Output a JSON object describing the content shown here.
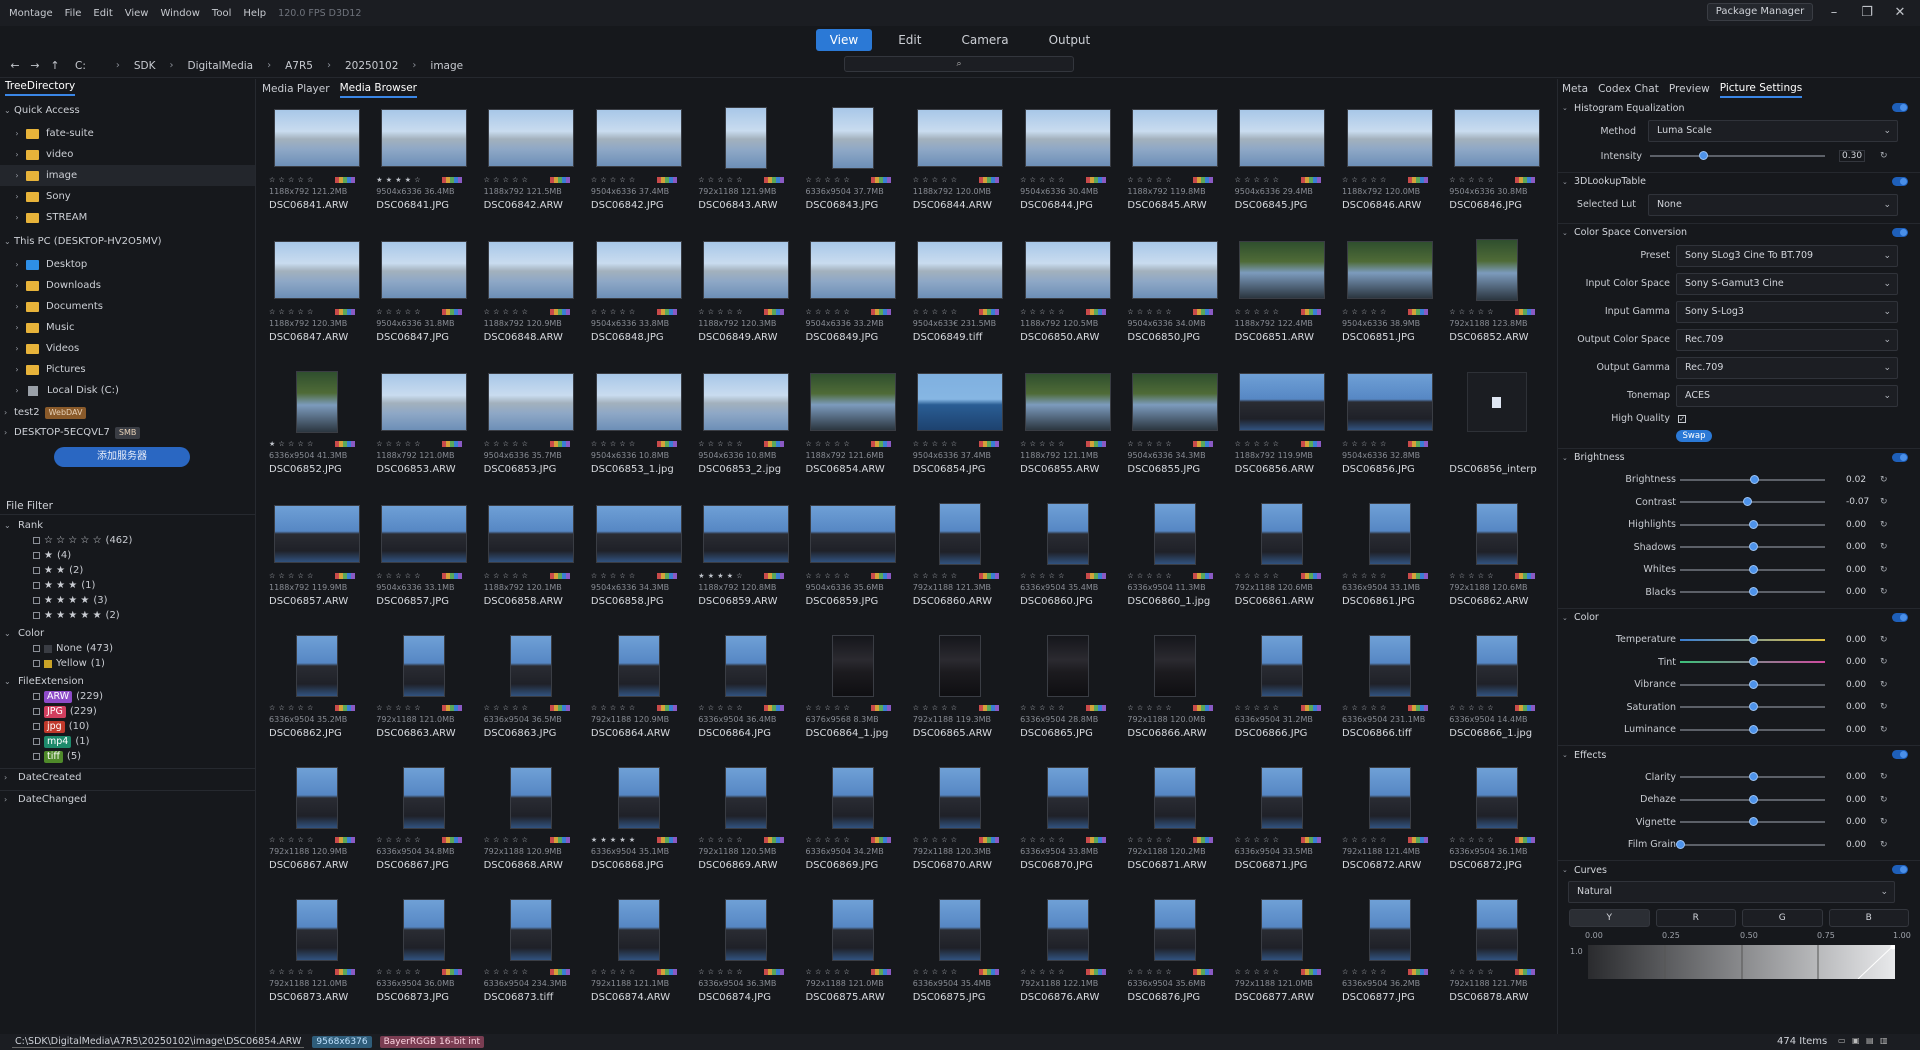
{
  "menubar": {
    "items": [
      "Montage",
      "File",
      "Edit",
      "View",
      "Window",
      "Tool",
      "Help"
    ],
    "fps": "120.0 FPS  D3D12",
    "package_manager": "Package Manager"
  },
  "modes": [
    "View",
    "Edit",
    "Camera",
    "Output"
  ],
  "path": {
    "crumbs": [
      "C:",
      "SDK",
      "DigitalMedia",
      "A7R5",
      "20250102",
      "image"
    ],
    "search_icon": "search-icon"
  },
  "left": {
    "tabs": [
      "TreeDirectory"
    ],
    "quick_access": "Quick Access",
    "quick_items": [
      "fate-suite",
      "video",
      "image",
      "Sony",
      "STREAM"
    ],
    "this_pc": "This PC (DESKTOP-HV2O5MV)",
    "pc_items": [
      "Desktop",
      "Downloads",
      "Documents",
      "Music",
      "Videos",
      "Pictures",
      "Local Disk (C:)"
    ],
    "remote": [
      {
        "name": "test2",
        "badge": "WebDAV",
        "color": "#8a5a2a"
      },
      {
        "name": "DESKTOP-5ECQVL7",
        "badge": "SMB",
        "color": "#3a3d44"
      }
    ],
    "add_server": "添加服务器"
  },
  "filter": {
    "title": "File Filter",
    "rank_label": "Rank",
    "rank": [
      {
        "stars": "☆ ☆ ☆ ☆ ☆",
        "count": "(462)"
      },
      {
        "stars": "★",
        "count": "(4)"
      },
      {
        "stars": "★ ★",
        "count": "(2)"
      },
      {
        "stars": "★ ★ ★",
        "count": "(1)"
      },
      {
        "stars": "★ ★ ★ ★",
        "count": "(3)"
      },
      {
        "stars": "★ ★ ★ ★ ★",
        "count": "(2)"
      }
    ],
    "color_label": "Color",
    "colors": [
      {
        "name": "None",
        "count": "(473)",
        "color": "#3a3d44"
      },
      {
        "name": "Yellow",
        "count": "(1)",
        "color": "#c9a227"
      }
    ],
    "ext_label": "FileExtension",
    "exts": [
      {
        "name": "ARW",
        "count": "(229)",
        "color": "#8e4bc8"
      },
      {
        "name": "JPG",
        "count": "(229)",
        "color": "#d13f5f"
      },
      {
        "name": "jpg",
        "count": "(10)",
        "color": "#c0392b"
      },
      {
        "name": "mp4",
        "count": "(1)",
        "color": "#1d8a6b"
      },
      {
        "name": "tiff",
        "count": "(5)",
        "color": "#4f8a2a"
      }
    ],
    "date_created": "DateCreated",
    "date_changed": "DateChanged"
  },
  "center": {
    "tabs": [
      "Media Player",
      "Media Browser"
    ]
  },
  "files": [
    {
      "n": "DSC06841.ARW",
      "m": "1188x792  121.2MB",
      "t": "sky",
      "o": "l",
      "r": "☆ ☆ ☆ ☆ ☆"
    },
    {
      "n": "DSC06841.JPG",
      "m": "9504x6336  36.4MB",
      "t": "sky",
      "o": "l",
      "r": "★ ★ ★ ★ ☆"
    },
    {
      "n": "DSC06842.ARW",
      "m": "1188x792  121.5MB",
      "t": "sky",
      "o": "l",
      "r": "☆ ☆ ☆ ☆ ☆"
    },
    {
      "n": "DSC06842.JPG",
      "m": "9504x6336  37.4MB",
      "t": "sky",
      "o": "l",
      "r": "☆ ☆ ☆ ☆ ☆"
    },
    {
      "n": "DSC06843.ARW",
      "m": "792x1188  121.9MB",
      "t": "sky",
      "o": "p",
      "r": "☆ ☆ ☆ ☆ ☆"
    },
    {
      "n": "DSC06843.JPG",
      "m": "6336x9504  37.7MB",
      "t": "sky",
      "o": "p",
      "r": "☆ ☆ ☆ ☆ ☆"
    },
    {
      "n": "DSC06844.ARW",
      "m": "1188x792  120.0MB",
      "t": "sky",
      "o": "l",
      "r": "☆ ☆ ☆ ☆ ☆"
    },
    {
      "n": "DSC06844.JPG",
      "m": "9504x6336  30.4MB",
      "t": "sky",
      "o": "l",
      "r": "☆ ☆ ☆ ☆ ☆"
    },
    {
      "n": "DSC06845.ARW",
      "m": "1188x792  119.8MB",
      "t": "sky",
      "o": "l",
      "r": "☆ ☆ ☆ ☆ ☆"
    },
    {
      "n": "DSC06845.JPG",
      "m": "9504x6336  29.4MB",
      "t": "sky",
      "o": "l",
      "r": "☆ ☆ ☆ ☆ ☆"
    },
    {
      "n": "DSC06846.ARW",
      "m": "1188x792  120.0MB",
      "t": "sky",
      "o": "l",
      "r": "☆ ☆ ☆ ☆ ☆"
    },
    {
      "n": "DSC06846.JPG",
      "m": "9504x6336  30.8MB",
      "t": "sky",
      "o": "l",
      "r": "☆ ☆ ☆ ☆ ☆"
    },
    {
      "n": "DSC06847.ARW",
      "m": "1188x792  120.3MB",
      "t": "sky",
      "o": "l",
      "r": "☆ ☆ ☆ ☆ ☆"
    },
    {
      "n": "DSC06847.JPG",
      "m": "9504x6336  31.8MB",
      "t": "sky",
      "o": "l",
      "r": "☆ ☆ ☆ ☆ ☆"
    },
    {
      "n": "DSC06848.ARW",
      "m": "1188x792  120.9MB",
      "t": "sky",
      "o": "l",
      "r": "☆ ☆ ☆ ☆ ☆"
    },
    {
      "n": "DSC06848.JPG",
      "m": "9504x6336  33.8MB",
      "t": "sky",
      "o": "l",
      "r": "☆ ☆ ☆ ☆ ☆"
    },
    {
      "n": "DSC06849.ARW",
      "m": "1188x792  120.3MB",
      "t": "sky",
      "o": "l",
      "r": "☆ ☆ ☆ ☆ ☆"
    },
    {
      "n": "DSC06849.JPG",
      "m": "9504x6336  33.2MB",
      "t": "sky",
      "o": "l",
      "r": "☆ ☆ ☆ ☆ ☆"
    },
    {
      "n": "DSC06849.tiff",
      "m": "9504x633€ 231.5MB",
      "t": "sky",
      "o": "l",
      "r": "☆ ☆ ☆ ☆ ☆"
    },
    {
      "n": "DSC06850.ARW",
      "m": "1188x792  120.5MB",
      "t": "sky",
      "o": "l",
      "r": "☆ ☆ ☆ ☆ ☆"
    },
    {
      "n": "DSC06850.JPG",
      "m": "9504x6336  34.0MB",
      "t": "sky",
      "o": "l",
      "r": "☆ ☆ ☆ ☆ ☆"
    },
    {
      "n": "DSC06851.ARW",
      "m": "1188x792  122.4MB",
      "t": "green",
      "o": "l",
      "r": "☆ ☆ ☆ ☆ ☆"
    },
    {
      "n": "DSC06851.JPG",
      "m": "9504x6336  38.9MB",
      "t": "green",
      "o": "l",
      "r": "☆ ☆ ☆ ☆ ☆"
    },
    {
      "n": "DSC06852.ARW",
      "m": "792x1188  123.8MB",
      "t": "green",
      "o": "p",
      "r": "☆ ☆ ☆ ☆ ☆"
    },
    {
      "n": "DSC06852.JPG",
      "m": "6336x9504  41.3MB",
      "t": "green",
      "o": "p",
      "r": "★ ☆ ☆ ☆ ☆"
    },
    {
      "n": "DSC06853.ARW",
      "m": "1188x792  121.0MB",
      "t": "sky",
      "o": "l",
      "r": "☆ ☆ ☆ ☆ ☆"
    },
    {
      "n": "DSC06853.JPG",
      "m": "9504x6336  35.7MB",
      "t": "sky",
      "o": "l",
      "r": "☆ ☆ ☆ ☆ ☆"
    },
    {
      "n": "DSC06853_1.jpg",
      "m": "9504x6336  10.8MB",
      "t": "sky",
      "o": "l",
      "r": "☆ ☆ ☆ ☆ ☆"
    },
    {
      "n": "DSC06853_2.jpg",
      "m": "9504x6336  10.8MB",
      "t": "sky",
      "o": "l",
      "r": "☆ ☆ ☆ ☆ ☆"
    },
    {
      "n": "DSC06854.ARW",
      "m": "1188x792  121.6MB",
      "t": "green",
      "o": "l",
      "r": "☆ ☆ ☆ ☆ ☆"
    },
    {
      "n": "DSC06854.JPG",
      "m": "9504x6336  37.4MB",
      "t": "bluewt",
      "o": "l",
      "r": "☆ ☆ ☆ ☆ ☆"
    },
    {
      "n": "DSC06855.ARW",
      "m": "1188x792  121.1MB",
      "t": "green",
      "o": "l",
      "r": "☆ ☆ ☆ ☆ ☆"
    },
    {
      "n": "DSC06855.JPG",
      "m": "9504x6336  34.3MB",
      "t": "green",
      "o": "l",
      "r": "☆ ☆ ☆ ☆ ☆"
    },
    {
      "n": "DSC06856.ARW",
      "m": "1188x792  119.9MB",
      "t": "pers",
      "o": "l",
      "r": "☆ ☆ ☆ ☆ ☆"
    },
    {
      "n": "DSC06856.JPG",
      "m": "9504x6336  32.8MB",
      "t": "pers",
      "o": "l",
      "r": "☆ ☆ ☆ ☆ ☆"
    },
    {
      "n": "DSC06856_interp",
      "m": "",
      "t": "doc",
      "o": "d",
      "r": ""
    },
    {
      "n": "DSC06857.ARW",
      "m": "1188x792  119.9MB",
      "t": "pers",
      "o": "l",
      "r": "☆ ☆ ☆ ☆ ☆"
    },
    {
      "n": "DSC06857.JPG",
      "m": "9504x6336  33.1MB",
      "t": "pers",
      "o": "l",
      "r": "☆ ☆ ☆ ☆ ☆"
    },
    {
      "n": "DSC06858.ARW",
      "m": "1188x792  120.1MB",
      "t": "pers",
      "o": "l",
      "r": "☆ ☆ ☆ ☆ ☆"
    },
    {
      "n": "DSC06858.JPG",
      "m": "9504x6336  34.3MB",
      "t": "pers",
      "o": "l",
      "r": "☆ ☆ ☆ ☆ ☆"
    },
    {
      "n": "DSC06859.ARW",
      "m": "1188x792  120.8MB",
      "t": "pers",
      "o": "l",
      "r": "★ ★ ★ ★ ☆"
    },
    {
      "n": "DSC06859.JPG",
      "m": "9504x6336  35.6MB",
      "t": "pers",
      "o": "l",
      "r": "☆ ☆ ☆ ☆ ☆"
    },
    {
      "n": "DSC06860.ARW",
      "m": "792x1188  121.3MB",
      "t": "pers",
      "o": "p",
      "r": "☆ ☆ ☆ ☆ ☆"
    },
    {
      "n": "DSC06860.JPG",
      "m": "6336x9504  35.4MB",
      "t": "pers",
      "o": "p",
      "r": "☆ ☆ ☆ ☆ ☆"
    },
    {
      "n": "DSC06860_1.jpg",
      "m": "6336x9504  11.3MB",
      "t": "pers",
      "o": "p",
      "r": "☆ ☆ ☆ ☆ ☆"
    },
    {
      "n": "DSC06861.ARW",
      "m": "792x1188  120.6MB",
      "t": "pers",
      "o": "p",
      "r": "☆ ☆ ☆ ☆ ☆"
    },
    {
      "n": "DSC06861.JPG",
      "m": "6336x9504  33.1MB",
      "t": "pers",
      "o": "p",
      "r": "☆ ☆ ☆ ☆ ☆"
    },
    {
      "n": "DSC06862.ARW",
      "m": "792x1188  120.6MB",
      "t": "pers",
      "o": "p",
      "r": "☆ ☆ ☆ ☆ ☆"
    },
    {
      "n": "DSC06862.JPG",
      "m": "6336x9504  35.2MB",
      "t": "pers",
      "o": "p",
      "r": "☆ ☆ ☆ ☆ ☆"
    },
    {
      "n": "DSC06863.ARW",
      "m": "792x1188  121.0MB",
      "t": "pers",
      "o": "p",
      "r": "☆ ☆ ☆ ☆ ☆"
    },
    {
      "n": "DSC06863.JPG",
      "m": "6336x9504  36.5MB",
      "t": "pers",
      "o": "p",
      "r": "☆ ☆ ☆ ☆ ☆"
    },
    {
      "n": "DSC06864.ARW",
      "m": "792x1188  120.9MB",
      "t": "pers",
      "o": "p",
      "r": "☆ ☆ ☆ ☆ ☆"
    },
    {
      "n": "DSC06864.JPG",
      "m": "6336x9504  36.4MB",
      "t": "pers",
      "o": "p",
      "r": "☆ ☆ ☆ ☆ ☆"
    },
    {
      "n": "DSC06864_1.jpg",
      "m": "6376x9568  8.3MB",
      "t": "night",
      "o": "p",
      "r": "☆ ☆ ☆ ☆ ☆"
    },
    {
      "n": "DSC06865.ARW",
      "m": "792x1188  119.3MB",
      "t": "night",
      "o": "p",
      "r": "☆ ☆ ☆ ☆ ☆"
    },
    {
      "n": "DSC06865.JPG",
      "m": "6336x9504  28.8MB",
      "t": "night",
      "o": "p",
      "r": "☆ ☆ ☆ ☆ ☆"
    },
    {
      "n": "DSC06866.ARW",
      "m": "792x1188  120.0MB",
      "t": "night",
      "o": "p",
      "r": "☆ ☆ ☆ ☆ ☆"
    },
    {
      "n": "DSC06866.JPG",
      "m": "6336x9504  31.2MB",
      "t": "pers",
      "o": "p",
      "r": "☆ ☆ ☆ ☆ ☆"
    },
    {
      "n": "DSC06866.tiff",
      "m": "6336x9504 231.1MB",
      "t": "pers",
      "o": "p",
      "r": "☆ ☆ ☆ ☆ ☆"
    },
    {
      "n": "DSC06866_1.jpg",
      "m": "6336x9504  14.4MB",
      "t": "pers",
      "o": "p",
      "r": "☆ ☆ ☆ ☆ ☆"
    },
    {
      "n": "DSC06867.ARW",
      "m": "792x1188  120.9MB",
      "t": "pers",
      "o": "p",
      "r": "☆ ☆ ☆ ☆ ☆"
    },
    {
      "n": "DSC06867.JPG",
      "m": "6336x9504  34.8MB",
      "t": "pers",
      "o": "p",
      "r": "☆ ☆ ☆ ☆ ☆"
    },
    {
      "n": "DSC06868.ARW",
      "m": "792x1188  120.9MB",
      "t": "pers",
      "o": "p",
      "r": "☆ ☆ ☆ ☆ ☆"
    },
    {
      "n": "DSC06868.JPG",
      "m": "6336x9504  35.1MB",
      "t": "pers",
      "o": "p",
      "r": "★ ★ ★ ★ ★"
    },
    {
      "n": "DSC06869.ARW",
      "m": "792x1188  120.5MB",
      "t": "pers",
      "o": "p",
      "r": "☆ ☆ ☆ ☆ ☆"
    },
    {
      "n": "DSC06869.JPG",
      "m": "6336x9504  34.2MB",
      "t": "pers",
      "o": "p",
      "r": "☆ ☆ ☆ ☆ ☆"
    },
    {
      "n": "DSC06870.ARW",
      "m": "792x1188  120.3MB",
      "t": "pers",
      "o": "p",
      "r": "☆ ☆ ☆ ☆ ☆"
    },
    {
      "n": "DSC06870.JPG",
      "m": "6336x9504  33.8MB",
      "t": "pers",
      "o": "p",
      "r": "☆ ☆ ☆ ☆ ☆"
    },
    {
      "n": "DSC06871.ARW",
      "m": "792x1188  120.2MB",
      "t": "pers",
      "o": "p",
      "r": "☆ ☆ ☆ ☆ ☆"
    },
    {
      "n": "DSC06871.JPG",
      "m": "6336x9504  33.5MB",
      "t": "pers",
      "o": "p",
      "r": "☆ ☆ ☆ ☆ ☆"
    },
    {
      "n": "DSC06872.ARW",
      "m": "792x1188  121.4MB",
      "t": "pers",
      "o": "p",
      "r": "☆ ☆ ☆ ☆ ☆"
    },
    {
      "n": "DSC06872.JPG",
      "m": "6336x9504  36.1MB",
      "t": "pers",
      "o": "p",
      "r": "☆ ☆ ☆ ☆ ☆"
    },
    {
      "n": "DSC06873.ARW",
      "m": "792x1188  121.0MB",
      "t": "pers",
      "o": "p",
      "r": "☆ ☆ ☆ ☆ ☆"
    },
    {
      "n": "DSC06873.JPG",
      "m": "6336x9504  36.0MB",
      "t": "pers",
      "o": "p",
      "r": "☆ ☆ ☆ ☆ ☆"
    },
    {
      "n": "DSC06873.tiff",
      "m": "6336x9504 234.3MB",
      "t": "pers",
      "o": "p",
      "r": "☆ ☆ ☆ ☆ ☆"
    },
    {
      "n": "DSC06874.ARW",
      "m": "792x1188  121.1MB",
      "t": "pers",
      "o": "p",
      "r": "☆ ☆ ☆ ☆ ☆"
    },
    {
      "n": "DSC06874.JPG",
      "m": "6336x9504  36.3MB",
      "t": "pers",
      "o": "p",
      "r": "☆ ☆ ☆ ☆ ☆"
    },
    {
      "n": "DSC06875.ARW",
      "m": "792x1188  121.0MB",
      "t": "pers",
      "o": "p",
      "r": "☆ ☆ ☆ ☆ ☆"
    },
    {
      "n": "DSC06875.JPG",
      "m": "6336x9504  35.4MB",
      "t": "pers",
      "o": "p",
      "r": "☆ ☆ ☆ ☆ ☆"
    },
    {
      "n": "DSC06876.ARW",
      "m": "792x1188  122.1MB",
      "t": "pers",
      "o": "p",
      "r": "☆ ☆ ☆ ☆ ☆"
    },
    {
      "n": "DSC06876.JPG",
      "m": "6336x9504  35.6MB",
      "t": "pers",
      "o": "p",
      "r": "☆ ☆ ☆ ☆ ☆"
    },
    {
      "n": "DSC06877.ARW",
      "m": "792x1188  121.0MB",
      "t": "pers",
      "o": "p",
      "r": "☆ ☆ ☆ ☆ ☆"
    },
    {
      "n": "DSC06877.JPG",
      "m": "6336x9504  36.2MB",
      "t": "pers",
      "o": "p",
      "r": "☆ ☆ ☆ ☆ ☆"
    },
    {
      "n": "DSC06878.ARW",
      "m": "792x1188  121.7MB",
      "t": "pers",
      "o": "p",
      "r": "☆ ☆ ☆ ☆ ☆"
    }
  ],
  "right": {
    "tabs": [
      "Meta",
      "Codex Chat",
      "Preview",
      "Picture Settings"
    ],
    "hist": {
      "title": "Histogram Equalization",
      "method_label": "Method",
      "method": "Luma Scale",
      "intensity_label": "Intensity",
      "intensity": "0.30",
      "intensity_level": 0.3
    },
    "lut": {
      "title": "3DLookupTable",
      "label": "Selected Lut",
      "value": "None"
    },
    "csc": {
      "title": "Color Space Conversion",
      "rows": [
        {
          "label": "Preset",
          "value": "Sony SLog3 Cine To BT.709"
        },
        {
          "label": "Input Color Space",
          "value": "Sony S-Gamut3 Cine"
        },
        {
          "label": "Input Gamma",
          "value": "Sony S-Log3"
        },
        {
          "label": "Output Color Space",
          "value": "Rec.709"
        },
        {
          "label": "Output Gamma",
          "value": "Rec.709"
        },
        {
          "label": "Tonemap",
          "value": "ACES"
        }
      ],
      "hq_label": "High Quality",
      "swap": "Swap"
    },
    "brightness": {
      "title": "Brightness",
      "rows": [
        {
          "label": "Brightness",
          "value": "0.02",
          "level": 0.51
        },
        {
          "label": "Contrast",
          "value": "-0.07",
          "level": 0.465
        },
        {
          "label": "Highlights",
          "value": "0.00",
          "level": 0.5
        },
        {
          "label": "Shadows",
          "value": "0.00",
          "level": 0.5
        },
        {
          "label": "Whites",
          "value": "0.00",
          "level": 0.5
        },
        {
          "label": "Blacks",
          "value": "0.00",
          "level": 0.5
        }
      ]
    },
    "color": {
      "title": "Color",
      "rows": [
        {
          "label": "Temperature",
          "value": "0.00",
          "level": 0.5
        },
        {
          "label": "Tint",
          "value": "0.00",
          "level": 0.5
        },
        {
          "label": "Vibrance",
          "value": "0.00",
          "level": 0.5
        },
        {
          "label": "Saturation",
          "value": "0.00",
          "level": 0.5
        },
        {
          "label": "Luminance",
          "value": "0.00",
          "level": 0.5
        }
      ]
    },
    "effects": {
      "title": "Effects",
      "rows": [
        {
          "label": "Clarity",
          "value": "0.00",
          "level": 0.5
        },
        {
          "label": "Dehaze",
          "value": "0.00",
          "level": 0.5
        },
        {
          "label": "Vignette",
          "value": "0.00",
          "level": 0.5
        },
        {
          "label": "Film Grain",
          "value": "0.00",
          "level": 0
        }
      ]
    },
    "curves": {
      "title": "Curves",
      "preset": "Natural",
      "channels": [
        "Y",
        "R",
        "G",
        "B"
      ],
      "ticks": [
        "0.00",
        "0.25",
        "0.50",
        "0.75",
        "1.00"
      ],
      "y_tick": "1.0"
    }
  },
  "status": {
    "path": "C:\\SDK\\DigitalMedia\\A7R5\\20250102\\image\\DSC06854.ARW",
    "res": "9568x6376",
    "format": "BayerRGGB 16-bit int",
    "items": "474 Items"
  },
  "colors": {
    "accent": "#2b79d6",
    "folder": "#e7b33a"
  }
}
